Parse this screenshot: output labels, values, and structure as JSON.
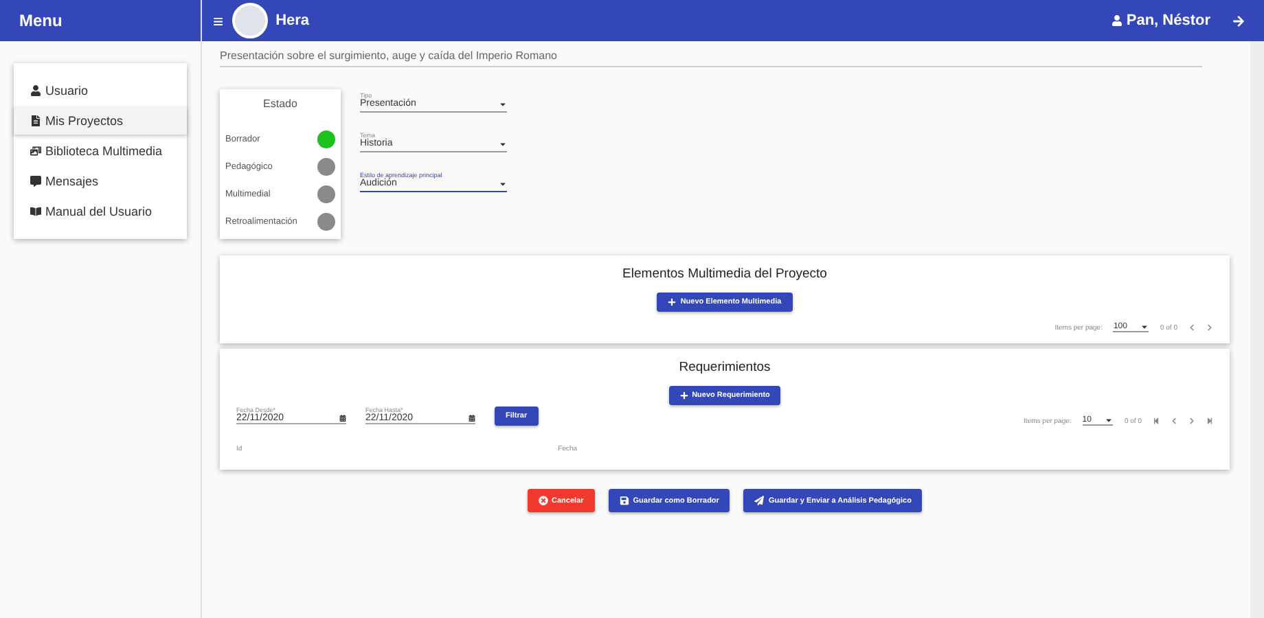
{
  "sidebar": {
    "title": "Menu",
    "items": [
      {
        "label": "Usuario",
        "selected": false
      },
      {
        "label": "Mis Proyectos",
        "selected": true
      },
      {
        "label": "Biblioteca Multimedia",
        "selected": false
      },
      {
        "label": "Mensajes",
        "selected": false
      },
      {
        "label": "Manual del Usuario",
        "selected": false
      }
    ]
  },
  "app_bar": {
    "menu_icon": "≡",
    "title": "Hera",
    "user": "Pan, Néstor"
  },
  "description": "Presentación sobre el surgimiento, auge y caída del Imperio Romano",
  "estado": {
    "title": "Estado",
    "stages": [
      {
        "label": "Borrador",
        "on": true
      },
      {
        "label": "Pedagógico",
        "on": false
      },
      {
        "label": "Multimedial",
        "on": false
      },
      {
        "label": "Retroalimentación",
        "on": false
      }
    ]
  },
  "selects": [
    {
      "label": "Tipo",
      "value": "Presentación",
      "focused": false
    },
    {
      "label": "Tema",
      "value": "Historia",
      "focused": false
    },
    {
      "label": "Estilo de aprendizaje principal",
      "value": "Audición",
      "focused": true
    }
  ],
  "multimedia": {
    "title": "Elementos Multimedia del Proyecto",
    "button": "Nuevo Elemento Multimedia",
    "paginator": {
      "label": "Items per page:",
      "size": "100",
      "range": "0 of 0"
    }
  },
  "requerimientos": {
    "title": "Requerimientos",
    "button": "Nuevo Requerimiento",
    "dates": [
      {
        "label": "Fecha Desde*",
        "value": "22/11/2020"
      },
      {
        "label": "Fecha Hasta*",
        "value": "22/11/2020"
      }
    ],
    "filter": "Filtrar",
    "paginator": {
      "label": "Items per page:",
      "size": "10",
      "range": "0 of 0"
    },
    "columns": [
      "Id",
      "Fecha"
    ]
  },
  "actions": [
    {
      "label": "Cancelar",
      "kind": "cancel"
    },
    {
      "label": "Guardar como Borrador",
      "kind": "save"
    },
    {
      "label": "Guardar y Enviar a Análisis Pedagógico",
      "kind": "send"
    }
  ]
}
